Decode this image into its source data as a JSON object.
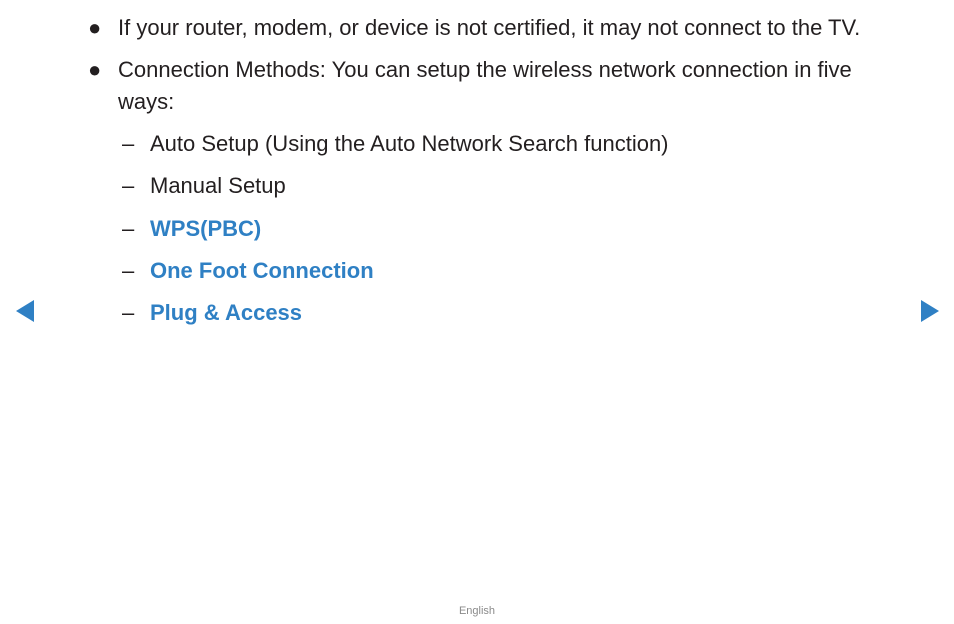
{
  "bullets": [
    {
      "marker": "●",
      "text": "If your router, modem, or device is not certified, it may not connect to the TV."
    },
    {
      "marker": "●",
      "text": "Connection Methods: You can setup the wireless network connection in five ways:"
    }
  ],
  "methods": [
    {
      "marker": "–",
      "text": "Auto Setup (Using the Auto Network Search function)",
      "is_link": false
    },
    {
      "marker": "–",
      "text": "Manual Setup",
      "is_link": false
    },
    {
      "marker": "–",
      "text": "WPS(PBC)",
      "is_link": true
    },
    {
      "marker": "–",
      "text": "One Foot Connection",
      "is_link": true
    },
    {
      "marker": "–",
      "text": "Plug & Access",
      "is_link": true
    }
  ],
  "navigation": {
    "prev_icon": "left-triangle-arrow",
    "next_icon": "right-triangle-arrow"
  },
  "footer": {
    "language": "English"
  },
  "colors": {
    "link": "#2f80c4",
    "text": "#231f20"
  }
}
